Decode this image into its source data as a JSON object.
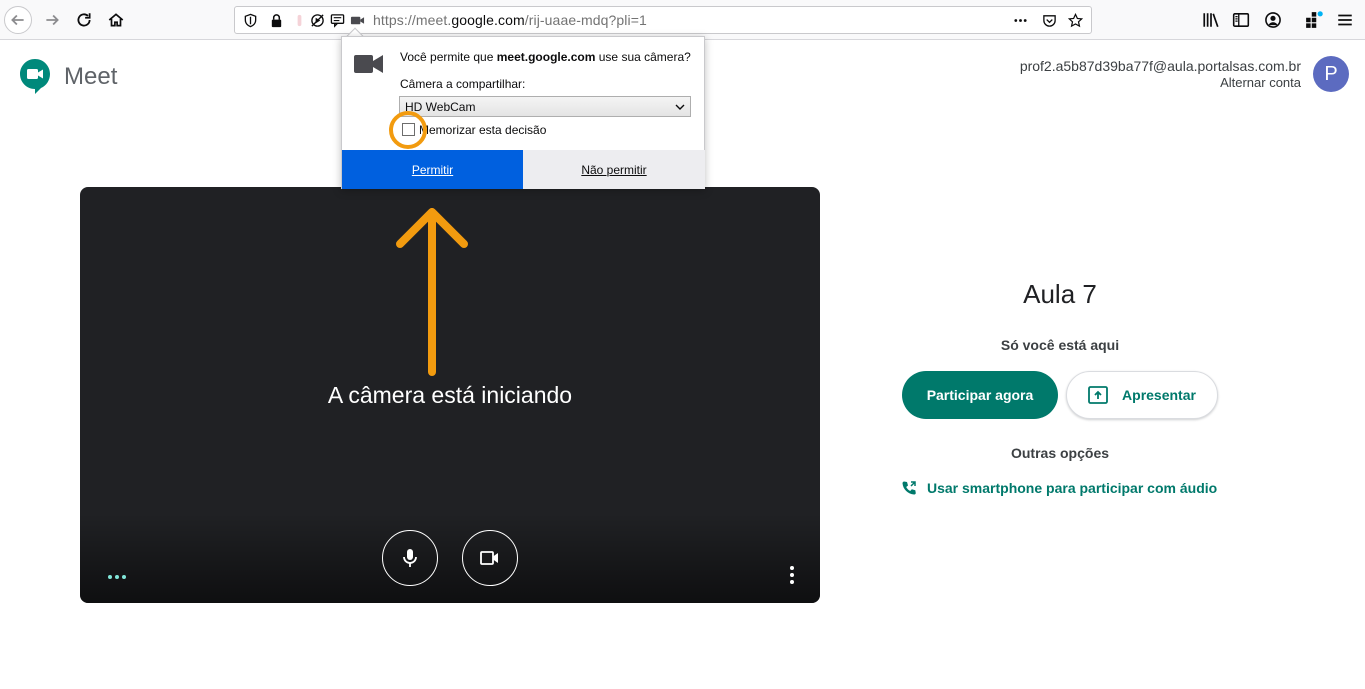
{
  "browser": {
    "url_prefix": "https://meet.",
    "url_domain": "google.com",
    "url_path": "/rij-uaae-mdq?pli=1"
  },
  "header": {
    "app_name": "Meet",
    "account_email": "prof2.a5b87d39ba77f@aula.portalsas.com.br",
    "switch_account": "Alternar conta",
    "avatar_letter": "P"
  },
  "preview": {
    "status_message": "A câmera está iniciando"
  },
  "panel": {
    "meeting_title": "Aula 7",
    "participants_text": "Só você está aqui",
    "join_label": "Participar agora",
    "present_label": "Apresentar",
    "other_options": "Outras opções",
    "phone_link": "Usar smartphone para participar com áudio"
  },
  "permission_popup": {
    "question_prefix": "Você permite que ",
    "question_domain": "meet.google.com",
    "question_suffix": " use sua câmera?",
    "camera_label": "Câmera a compartilhar:",
    "camera_selected": "HD WebCam",
    "remember_label": "Memorizar esta decisão",
    "allow_label": "Permitir",
    "deny_label": "Não permitir"
  },
  "colors": {
    "meet_green": "#00796b",
    "firefox_blue": "#0060df",
    "annotation_orange": "#f29b0f",
    "avatar": "#5c6bc0"
  },
  "icons": [
    "back-arrow-icon",
    "forward-arrow-icon",
    "reload-icon",
    "home-icon",
    "shield-icon",
    "lock-icon",
    "camera-icon",
    "library-icon",
    "sidebar-icon",
    "account-icon",
    "extensions-icon",
    "menu-icon",
    "bookmark-star-icon",
    "pocket-icon",
    "mic-icon",
    "phone-icon",
    "present-icon"
  ]
}
